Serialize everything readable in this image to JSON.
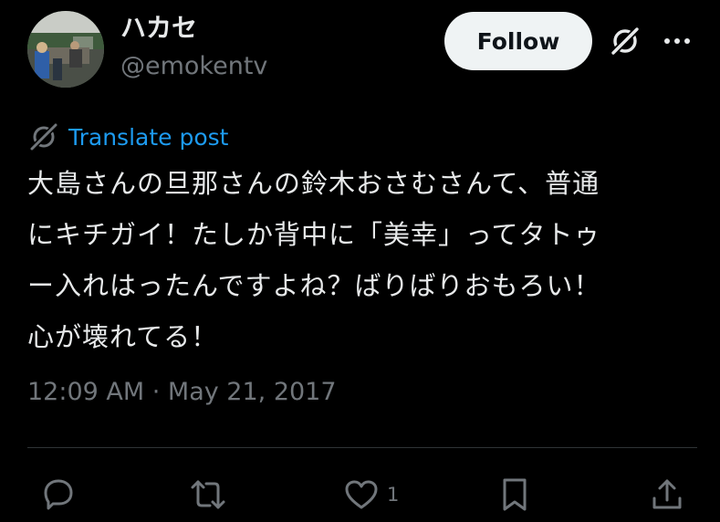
{
  "author": {
    "display_name": "ハカセ",
    "handle": "@emokentv",
    "avatar_icon": "avatar-photo"
  },
  "header": {
    "follow_label": "Follow",
    "grok_icon": "grok-icon",
    "more_icon": "more-icon"
  },
  "translate": {
    "label": "Translate post",
    "icon": "translate-icon",
    "color": "#1d9bf0"
  },
  "tweet": {
    "lines": [
      "大島さんの旦那さんの鈴木おさむさんて、普通",
      "にキチガイ！たしか背中に「美幸」ってタトゥ",
      "ー入れはったんですよね？ばりばりおもろい！",
      "心が壊れてる！"
    ],
    "timestamp": "12:09 AM · May 21, 2017"
  },
  "actions": {
    "reply_icon": "reply-icon",
    "retweet_icon": "retweet-icon",
    "like_icon": "heart-icon",
    "like_count": "1",
    "bookmark_icon": "bookmark-icon",
    "share_icon": "share-icon"
  },
  "colors": {
    "background": "#000000",
    "text_primary": "#e7e9ea",
    "text_secondary": "#71767b",
    "divider": "#2f3336",
    "follow_bg": "#eff3f4"
  }
}
